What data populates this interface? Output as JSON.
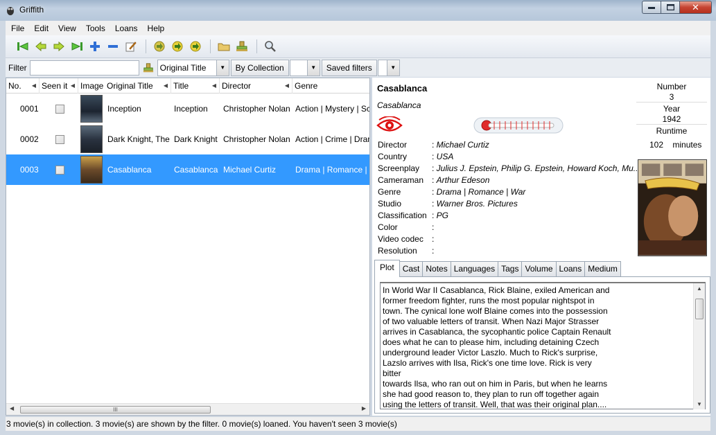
{
  "window": {
    "title": "Griffith"
  },
  "menu": [
    "File",
    "Edit",
    "View",
    "Tools",
    "Loans",
    "Help"
  ],
  "toolbar": {
    "groups": [
      [
        "go-first-icon",
        "go-previous-icon",
        "go-next-icon",
        "go-last-icon",
        "add-icon",
        "remove-icon",
        "edit-icon"
      ],
      [
        "nav-right-icon",
        "nav-right-alt-icon",
        "nav-right-alt2-icon"
      ],
      [
        "folder-icon",
        "stamp-icon"
      ],
      [
        "search-icon"
      ]
    ]
  },
  "filter": {
    "label": "Filter",
    "input_value": "",
    "field_select": "Original Title",
    "collection_label": "By Collection",
    "collection_value": "",
    "saved_filters_label": "Saved filters",
    "saved_filters_value": ""
  },
  "list": {
    "columns": [
      "No.",
      "Seen it",
      "Image",
      "Original Title",
      "Title",
      "Director",
      "Genre"
    ],
    "rows": [
      {
        "no": "0001",
        "original_title": "Inception",
        "title": "Inception",
        "director": "Christopher Nolan",
        "genre": "Action | Mystery | Sci-Fi",
        "seen": false,
        "selected": false,
        "poster_color": "#1c2430"
      },
      {
        "no": "0002",
        "original_title": "Dark Knight, The",
        "title": "Dark Knight",
        "director": "Christopher Nolan",
        "genre": "Action | Crime | Drama",
        "seen": false,
        "selected": false,
        "poster_color": "#2a3340"
      },
      {
        "no": "0003",
        "original_title": "Casablanca",
        "title": "Casablanca",
        "director": "Michael Curtiz",
        "genre": "Drama | Romance | War",
        "seen": false,
        "selected": true,
        "poster_color": "#6b4a2a"
      }
    ],
    "hscroll_thumb": "III"
  },
  "details": {
    "title": "Casablanca",
    "original_title": "Casablanca",
    "fields": [
      {
        "label": "Director",
        "value": "Michael Curtiz"
      },
      {
        "label": "Country",
        "value": "USA"
      },
      {
        "label": "Screenplay",
        "value": "Julius J. Epstein, Philip G. Epstein, Howard Koch, Mu..."
      },
      {
        "label": "Cameraman",
        "value": "Arthur Edeson"
      },
      {
        "label": "Genre",
        "value": "Drama | Romance | War"
      },
      {
        "label": "Studio",
        "value": "Warner Bros. Pictures"
      },
      {
        "label": "Classification",
        "value": "PG"
      },
      {
        "label": "Color",
        "value": ""
      },
      {
        "label": "Video codec",
        "value": ""
      },
      {
        "label": "Resolution",
        "value": ""
      }
    ],
    "number_label": "Number",
    "number": "3",
    "year_label": "Year",
    "year": "1942",
    "runtime_label": "Runtime",
    "runtime": "102",
    "runtime_unit": "minutes",
    "rating_fraction": 0.0,
    "tabs": [
      "Plot",
      "Cast",
      "Notes",
      "Languages",
      "Tags",
      "Volume",
      "Loans",
      "Medium"
    ],
    "active_tab": "Plot",
    "plot": "In World War II Casablanca, Rick Blaine, exiled American and\nformer freedom fighter, runs the most popular nightspot in\ntown. The cynical lone wolf Blaine comes into the possession\nof two valuable letters of transit. When Nazi Major Strasser\narrives in Casablanca, the sycophantic police Captain Renault\ndoes what he can to please him, including detaining Czech\nunderground leader Victor Laszlo. Much to Rick's surprise,\nLazslo arrives with Ilsa, Rick's one time love. Rick is very bitter\ntowards Ilsa, who ran out on him in Paris, but when he learns\nshe had good reason to, they plan to run off together again\nusing the letters of transit. Well, that was their original plan...."
  },
  "status": "3 movie(s) in collection. 3 movie(s) are shown by the filter. 0 movie(s) loaned. You haven't seen 3 movie(s)"
}
